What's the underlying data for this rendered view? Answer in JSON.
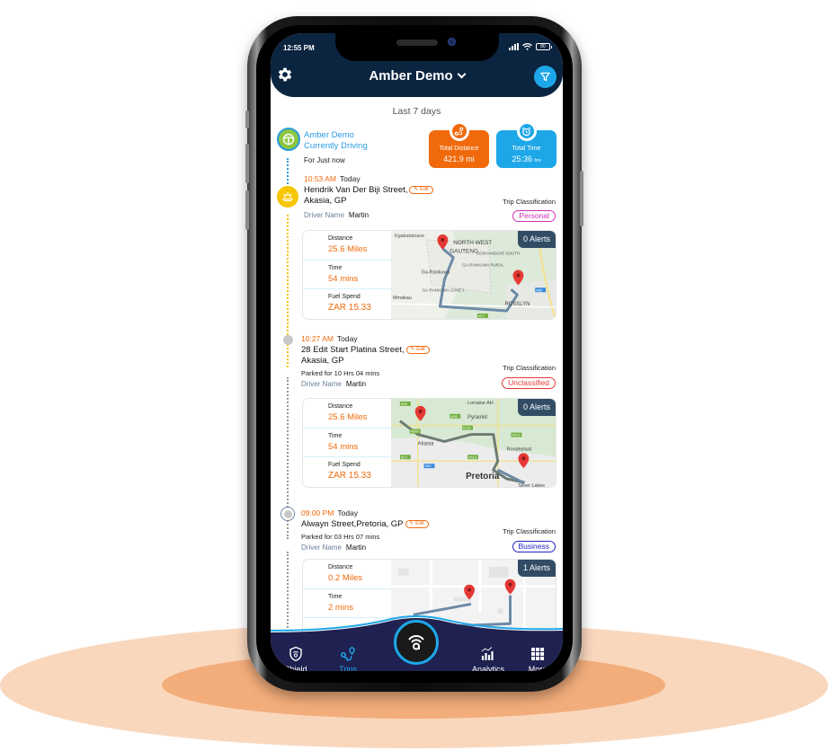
{
  "status_bar": {
    "time": "12:55 PM",
    "battery": "80"
  },
  "header": {
    "title": "Amber Demo"
  },
  "range_label": "Last 7 days",
  "current": {
    "driver": "Amber Demo",
    "status": "Currently Driving",
    "since": "For Just now"
  },
  "stats": {
    "distance": {
      "label": "Total Distance",
      "value": "421.9 mi"
    },
    "time": {
      "label": "Total Time",
      "value": "25:36",
      "unit": "hrs"
    }
  },
  "trips": [
    {
      "time": "10:53 AM",
      "day": "Today",
      "address_line1": "Hendrik Van Der Biji Street,",
      "address_line2": "Akasia, GP",
      "parked": "",
      "driver_label": "Driver Name",
      "driver": "Martin",
      "classification_label": "Trip Classification",
      "classification": "Personal",
      "classification_color": "#d12fbf",
      "edit_label": "Edit",
      "distance_label": "Distance",
      "distance": "25.6 Miles",
      "time_label": "Time",
      "duration": "54 mins",
      "fuel_label": "Fuel Spend",
      "fuel": "ZAR  15.33",
      "alerts": "0 Alerts",
      "map_labels": [
        "Kgabalatsane",
        "NORTH WEST",
        "GAUTENG",
        "SOSHANGUVE SOUTH",
        "GA-RANKUWA RURAL",
        "Ga-Rankuwa",
        "GA-RANKUWA ZONE 1",
        "Mmakau",
        "ROSSLYN",
        "M17",
        "R80"
      ]
    },
    {
      "time": "10:27 AM",
      "day": "Today",
      "address_line1": "28 Edit Start Platina Street,",
      "address_line2": "Akasia, GP",
      "parked": "Parked for 10 Hrs 04 mins",
      "driver_label": "Driver Name",
      "driver": "Martin",
      "classification_label": "Trip Classification",
      "classification": "Unclassified",
      "classification_color": "#e53935",
      "edit_label": "Edit",
      "distance_label": "Distance",
      "distance": "25.6 Miles",
      "time_label": "Time",
      "duration": "54 mins",
      "fuel_label": "Fuel Spend",
      "fuel": "ZAR  15.33",
      "alerts": "0 Alerts",
      "map_labels": [
        "Lorraine AH",
        "Pyramid",
        "Akasia",
        "Roodeplaat",
        "Pretoria",
        "Silver Lakes",
        "M20",
        "M35",
        "R566",
        "R101",
        "R573",
        "M17",
        "R513",
        "R80"
      ]
    },
    {
      "time": "09:00 PM",
      "day": "Today",
      "address_line1": "Alwayn Street,Pretoria, GP",
      "address_line2": "",
      "parked": "Parked for 03 Hrs 07 mins",
      "driver_label": "Driver Name",
      "driver": "Martin",
      "classification_label": "Trip Classification",
      "classification": "Business",
      "classification_color": "#2323c8",
      "edit_label": "Edit",
      "distance_label": "Distance",
      "distance": "0.2 Miles",
      "time_label": "Time",
      "duration": "2 mins",
      "alerts": "1 Alerts"
    }
  ],
  "bottom_nav": [
    {
      "label": "Shield",
      "icon": "shield-icon"
    },
    {
      "label": "Trips",
      "icon": "trips-icon",
      "active": true
    },
    {
      "label": "",
      "icon": "amber-logo-icon"
    },
    {
      "label": "Analytics",
      "icon": "analytics-icon"
    },
    {
      "label": "More",
      "icon": "grid-icon"
    }
  ],
  "colors": {
    "header_bg": "#0b2440",
    "accent_orange": "#f06a0c",
    "accent_blue": "#1ea7e8",
    "nav_bg": "#1f2150",
    "alerts_bg": "#324c66"
  }
}
